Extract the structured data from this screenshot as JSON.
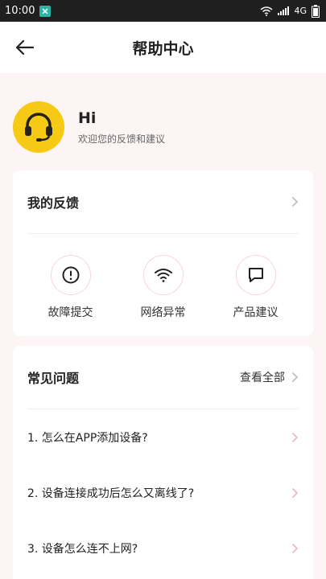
{
  "status_bar": {
    "time": "10:00",
    "network": "4G"
  },
  "nav": {
    "title": "帮助中心"
  },
  "greeting": {
    "hi": "Hi",
    "subtitle": "欢迎您的反馈和建议"
  },
  "feedback": {
    "title": "我的反馈",
    "items": [
      {
        "label": "故障提交",
        "icon": "exclamation-circle-icon"
      },
      {
        "label": "网络异常",
        "icon": "wifi-icon"
      },
      {
        "label": "产品建议",
        "icon": "chat-bubble-icon"
      }
    ]
  },
  "faq": {
    "title": "常见问题",
    "view_all": "查看全部",
    "items": [
      {
        "text": "1.  怎么在APP添加设备?"
      },
      {
        "text": "2.  设备连接成功后怎么又离线了?"
      },
      {
        "text": "3.  设备怎么连不上网?"
      }
    ]
  },
  "colors": {
    "accent": "#f6c915",
    "icon_ring": "#f6d6dc",
    "background": "#fdf5f5"
  }
}
